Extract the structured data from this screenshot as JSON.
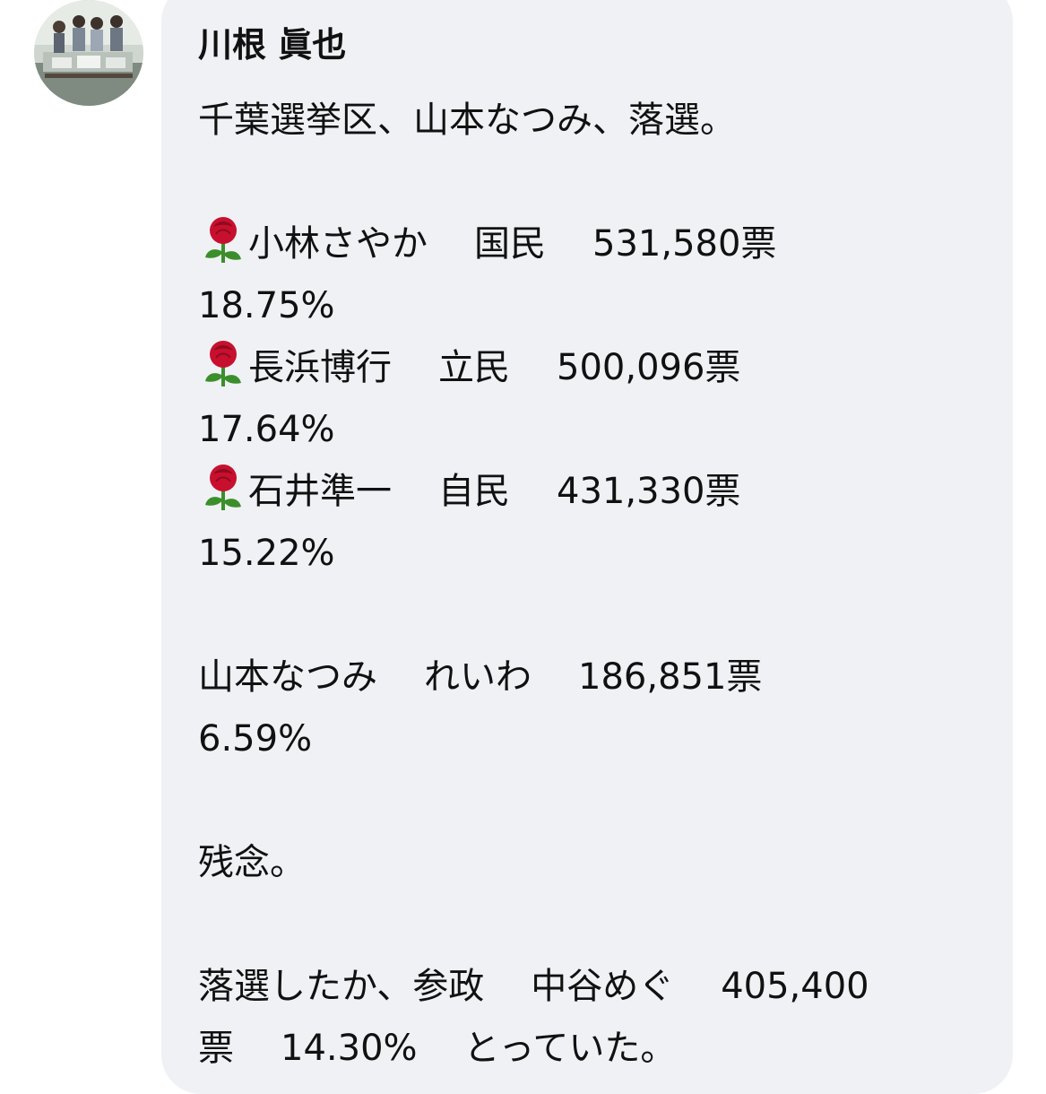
{
  "post": {
    "author": "川根 眞也",
    "lines": {
      "l1": "千葉選挙区、山本なつみ、落選。",
      "l3_name": "小林さやか",
      "l3_party": "国民",
      "l3_votes": "531,580票",
      "l4": "18.75%",
      "l5_name": "長浜博行",
      "l5_party": "立民",
      "l5_votes": "500,096票",
      "l6": "17.64%",
      "l7_name": "石井準一",
      "l7_party": "自民",
      "l7_votes": "431,330票",
      "l8": "15.22%",
      "l10_name": "山本なつみ",
      "l10_party": "れいわ",
      "l10_votes": "186,851票",
      "l11": "6.59%",
      "l13": "残念。",
      "l15_a": "落選したか、参政",
      "l15_b": "中谷めぐ",
      "l15_c": "405,400",
      "l16_a": "票",
      "l16_b": "14.30%",
      "l16_c": "とっていた。"
    },
    "emoji_icon": "rose-icon"
  },
  "colors": {
    "bubble_bg": "#f0f1f5",
    "text": "#111111",
    "rose": "#c8102e",
    "leaf": "#3a8f2b"
  }
}
